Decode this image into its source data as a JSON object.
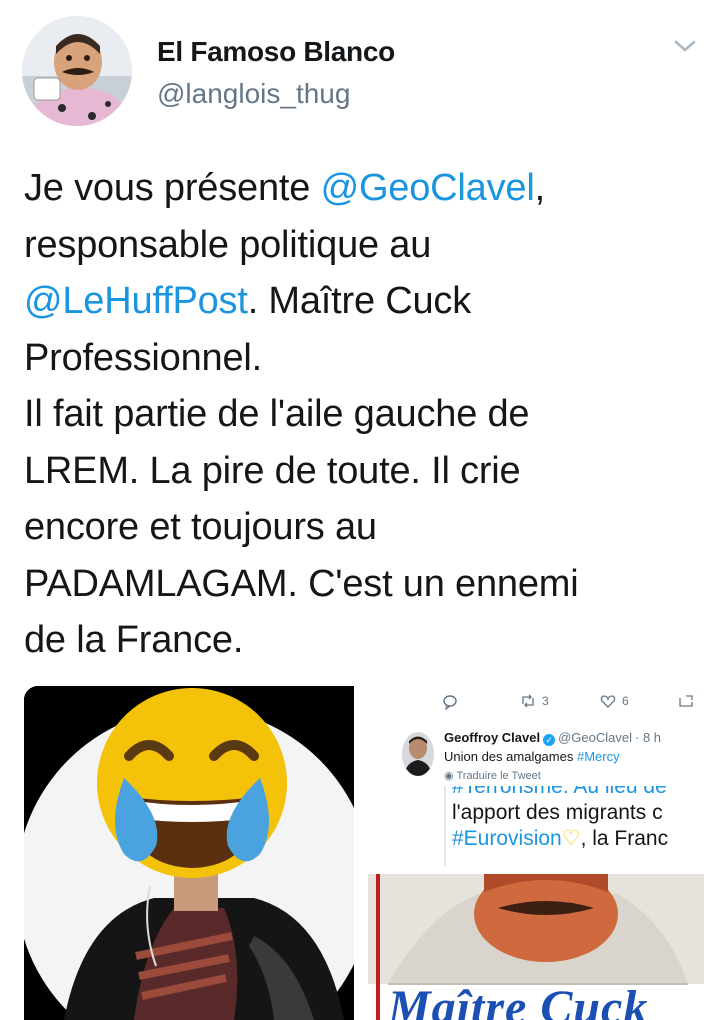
{
  "author": {
    "display_name": "El Famoso Blanco",
    "handle": "@langlois_thug"
  },
  "tweet": {
    "lines": [
      [
        {
          "t": "Je vous présente "
        },
        {
          "t": "@GeoClavel",
          "mention": true
        },
        {
          "t": ","
        }
      ],
      [
        {
          "t": "responsable politique au"
        }
      ],
      [
        {
          "t": "@LeHuffPost",
          "mention": true
        },
        {
          "t": ". Maître Cuck"
        }
      ],
      [
        {
          "t": "Professionnel."
        }
      ],
      [
        {
          "t": "Il fait partie de l'aile gauche de"
        }
      ],
      [
        {
          "t": "LREM. La pire de toute. Il crie"
        }
      ],
      [
        {
          "t": "encore et toujours au"
        }
      ],
      [
        {
          "t": "PADAMLAGAM. C'est un ennemi"
        }
      ],
      [
        {
          "t": "de la France."
        }
      ]
    ]
  },
  "embedded_tweet": {
    "retweets": "3",
    "likes": "6",
    "name": "Geoffroy Clavel",
    "handle": "@GeoClavel",
    "time": "· 8 h",
    "text_prefix": "Union des amalgames ",
    "hashtag": "#Mercy",
    "translate": "Traduire le Tweet",
    "quote_line1": "#Terrorisme. Au lieu de",
    "quote_line2": "l'apport des migrants c",
    "quote_line3_tag": "#Eurovision",
    "quote_line3_rest": ", la Franc"
  },
  "meme": {
    "caption": "Maître Cuck"
  },
  "colors": {
    "link": "#1b95e0",
    "text": "#14171a",
    "secondary": "#657786",
    "emoji_face": "#f5c20a",
    "tears": "#4aa3df"
  }
}
